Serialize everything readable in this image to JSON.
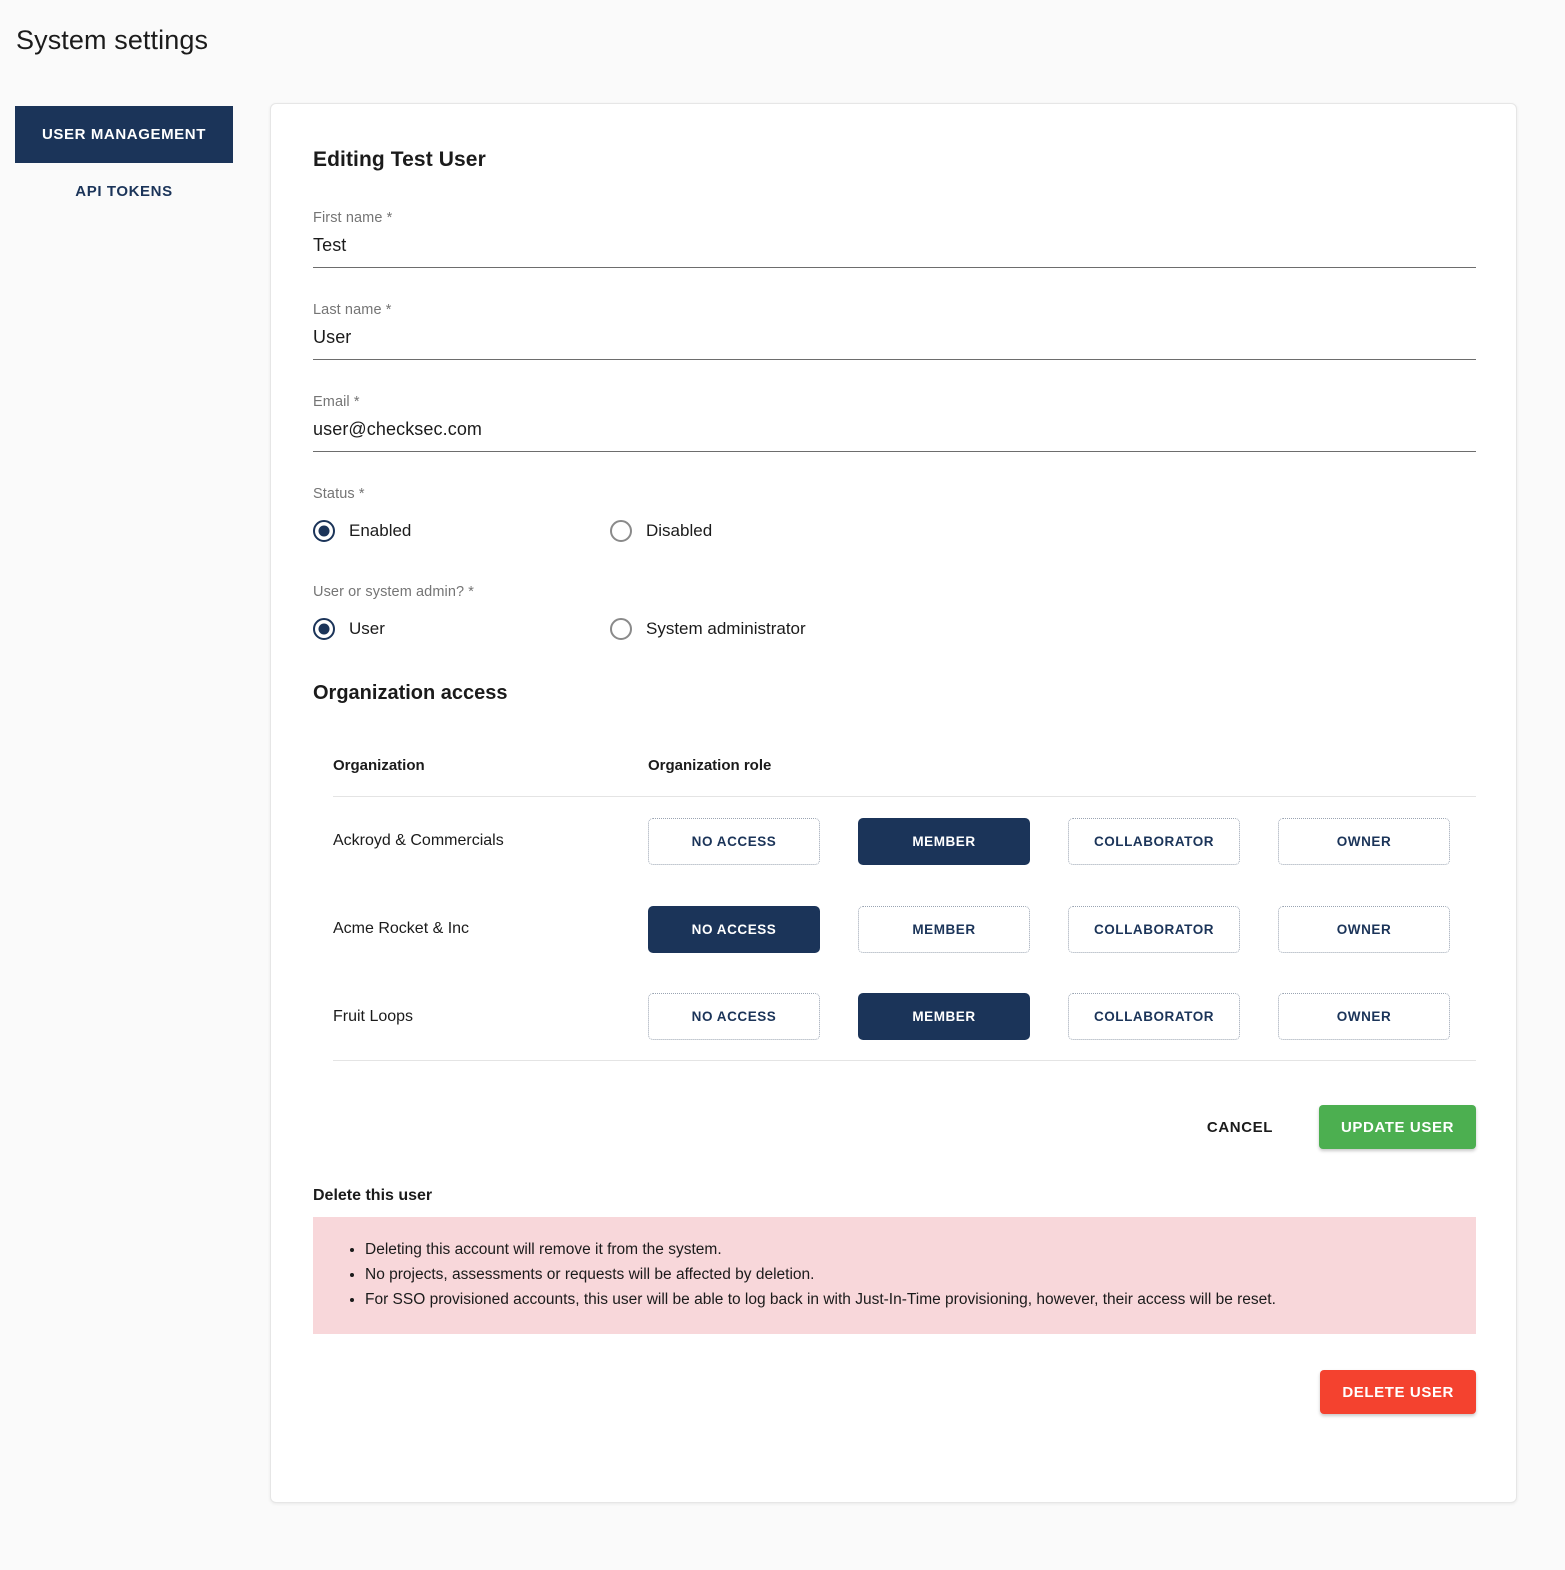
{
  "page": {
    "title": "System settings"
  },
  "sidebar": {
    "items": [
      {
        "label": "USER MANAGEMENT",
        "active": true
      },
      {
        "label": "API TOKENS",
        "active": false
      }
    ]
  },
  "form": {
    "heading": "Editing Test User",
    "fields": [
      {
        "label": "First name *",
        "value": "Test",
        "placeholder": ""
      },
      {
        "label": "Last name *",
        "value": "User",
        "placeholder": ""
      },
      {
        "label": "Email *",
        "value": "user@checksec.com",
        "placeholder": ""
      }
    ],
    "status": {
      "label": "Status *",
      "options": [
        {
          "label": "Enabled",
          "selected": true
        },
        {
          "label": "Disabled",
          "selected": false
        }
      ]
    },
    "admin": {
      "label": "User or system admin? *",
      "options": [
        {
          "label": "User",
          "selected": true
        },
        {
          "label": "System administrator",
          "selected": false
        }
      ]
    }
  },
  "org_access": {
    "section_title": "Organization access",
    "columns": {
      "organization": "Organization",
      "role": "Organization role"
    },
    "roles": [
      "NO ACCESS",
      "MEMBER",
      "COLLABORATOR",
      "OWNER"
    ],
    "rows": [
      {
        "organization": "Ackroyd & Commercials",
        "selected_role": "MEMBER"
      },
      {
        "organization": "Acme Rocket & Inc",
        "selected_role": "NO ACCESS"
      },
      {
        "organization": "Fruit Loops",
        "selected_role": "MEMBER"
      }
    ]
  },
  "actions": {
    "cancel": "CANCEL",
    "update": "UPDATE USER"
  },
  "delete_section": {
    "title": "Delete this user",
    "bullets": [
      "Deleting this account will remove it from the system.",
      "No projects, assessments or requests will be affected by deletion.",
      "For SSO provisioned accounts, this user will be able to log back in with Just-In-Time provisioning, however, their access will be reset."
    ],
    "delete_button": "DELETE USER"
  },
  "colors": {
    "navy": "#1b3459",
    "green": "#4caf50",
    "red": "#f4422f",
    "alert_bg": "#f8d7da",
    "page_bg": "#fafafa"
  }
}
